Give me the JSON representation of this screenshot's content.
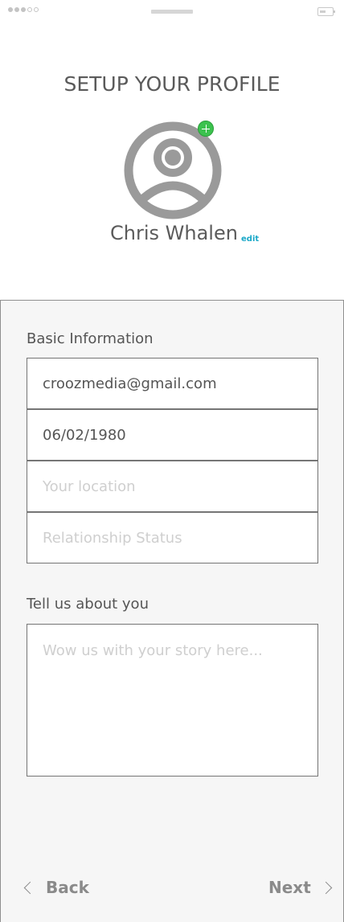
{
  "screen": {
    "title": "SETUP YOUR PROFILE"
  },
  "profile": {
    "name": "Chris Whalen",
    "edit_label": "edit",
    "avatar_icon": "user-avatar-icon",
    "add_photo_icon": "plus-circle-icon"
  },
  "basic_info": {
    "label": "Basic Information",
    "email": "croozmedia@gmail.com",
    "birthdate": "06/02/1980",
    "location_placeholder": "Your location",
    "relationship_placeholder": "Relationship Status"
  },
  "about": {
    "label": "Tell us about you",
    "story_placeholder": "Wow us with your story here..."
  },
  "navigation": {
    "back_label": "Back",
    "next_label": "Next"
  },
  "colors": {
    "accent": "#1aa8c8",
    "add_badge": "#3cc24e",
    "panel_background": "#f6f6f6"
  }
}
